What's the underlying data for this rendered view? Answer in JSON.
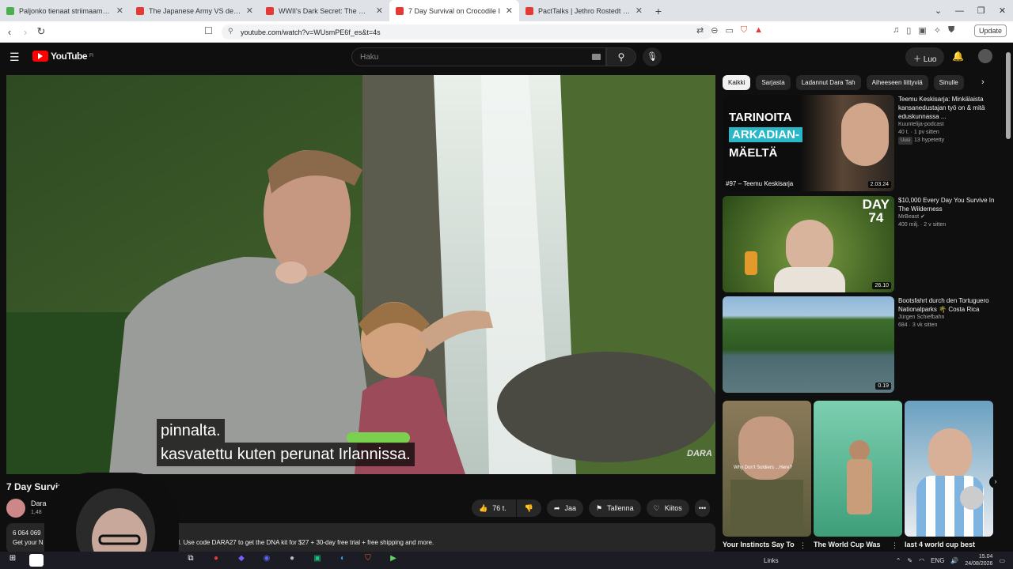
{
  "browser": {
    "tabs": [
      {
        "title": "Paljonko tienaat striimaamalla? - Las",
        "color": "#4caf50",
        "active": false
      },
      {
        "title": "The Japanese Army VS deadly Crocod",
        "color": "#e53935",
        "active": false
      },
      {
        "title": "WWII's Dark Secret: The Massacre of",
        "color": "#e53935",
        "active": false
      },
      {
        "title": "7 Day Survival on Crocodile I",
        "color": "#e53935",
        "active": true
      },
      {
        "title": "PactTalks | Jethro Rostedt | Vierasr",
        "color": "#e53935",
        "active": false
      }
    ],
    "new_tab": "+",
    "url": "youtube.com/watch?v=WUsmPE6f_es&t=4s",
    "update_label": "Update",
    "window_controls": [
      "⌄",
      "—",
      "❐",
      "✕"
    ]
  },
  "youtube": {
    "logo_text": "YouTube",
    "logo_region": "FI",
    "search_placeholder": "Haku",
    "create_label": "Luo",
    "icons": {
      "menu": "menu-icon",
      "search": "search-icon",
      "mic": "mic-icon",
      "bell": "bell-icon"
    }
  },
  "video": {
    "subtitle_line1": "pinnalta.",
    "subtitle_line2": "kasvatettu kuten perunat Irlannissa.",
    "watermark": "DARA",
    "title": "7 Day Survival on Croco",
    "channel": "Dara",
    "subscribers": "1,48",
    "like_count": "76 t.",
    "share_label": "Jaa",
    "save_label": "Tallenna",
    "thanks_label": "Kiitos",
    "more_label": "•••",
    "views": "6 064 069",
    "desc_prefix": "Get your N",
    "desc_text": "MH. Use code DARA27 to get the DNA kit for $27 + 30-day free trial + free shipping and more."
  },
  "sidebar": {
    "chips": [
      "Kaikki",
      "Sarjasta",
      "Ladannut Dara Tah",
      "Aiheeseen liittyviä",
      "Sinulle"
    ],
    "recommendations": [
      {
        "title": "Teemu Keskisarja: Minkälaista kansanedustajan työ on & mitä eduskunnassa ...",
        "channel": "Kuuntelija-podcast",
        "meta": "40 t. · 1 pv sitten",
        "badges": [
          "Uusi",
          "13 hypetetty"
        ],
        "duration": "2.03.24",
        "thumb_lines": [
          "TARINOITA",
          "ARKADIAN-",
          "MÄELTÄ"
        ],
        "thumb_caption": "#97 – Teemu Keskisarja"
      },
      {
        "title": "$10,000 Every Day You Survive In The Wilderness",
        "channel": "MrBeast",
        "meta": "400 milj. · 2 v sitten",
        "duration": "26.10",
        "thumb_lines": [
          "DAY",
          "74"
        ]
      },
      {
        "title": "Bootsfahrt durch den Tortuguero Nationalparks 🌴 Costa Rica",
        "channel": "Jürgen Schiefbahn",
        "meta": "684 · 3 vk sitten",
        "duration": "0.19"
      }
    ],
    "shorts": [
      {
        "title": "Your Instincts Say To",
        "overlay": "Why Don't Soldiers ...Here?"
      },
      {
        "title": "The World Cup Was"
      },
      {
        "title": "last 4 world cup best"
      }
    ]
  },
  "taskbar": {
    "links_label": "Links",
    "lang": "ENG",
    "time": "15.04",
    "date": "24/08/2026"
  }
}
